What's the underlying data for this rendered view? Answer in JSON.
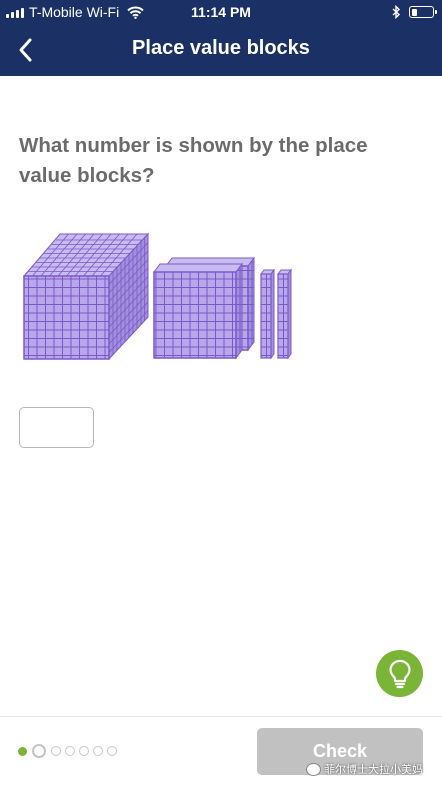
{
  "status_bar": {
    "carrier": "T-Mobile Wi-Fi",
    "time": "11:14 PM",
    "icons": [
      "signal-bars-icon",
      "wifi-icon",
      "bluetooth-icon",
      "battery-icon"
    ]
  },
  "nav": {
    "back_icon": "chevron-left-icon",
    "title": "Place value blocks"
  },
  "question": {
    "text": "What number is shown by the place value blocks?"
  },
  "blocks": {
    "thousands": 1,
    "hundreds": 2,
    "tens": 2,
    "ones": 0,
    "fill_color": "#b8a7ea",
    "line_color": "#7b59c9"
  },
  "answer": {
    "value": "",
    "placeholder": ""
  },
  "hint": {
    "icon": "lightbulb-icon",
    "color": "#7ab537"
  },
  "progress": {
    "completed": 1,
    "current": 2,
    "total": 7
  },
  "footer": {
    "check_label": "Check"
  },
  "watermark": {
    "text": "菲尔博士大拉小美妈"
  },
  "colors": {
    "header_bg": "#1b3166",
    "accent_green": "#7ab537",
    "check_disabled": "#c1c1c1"
  }
}
